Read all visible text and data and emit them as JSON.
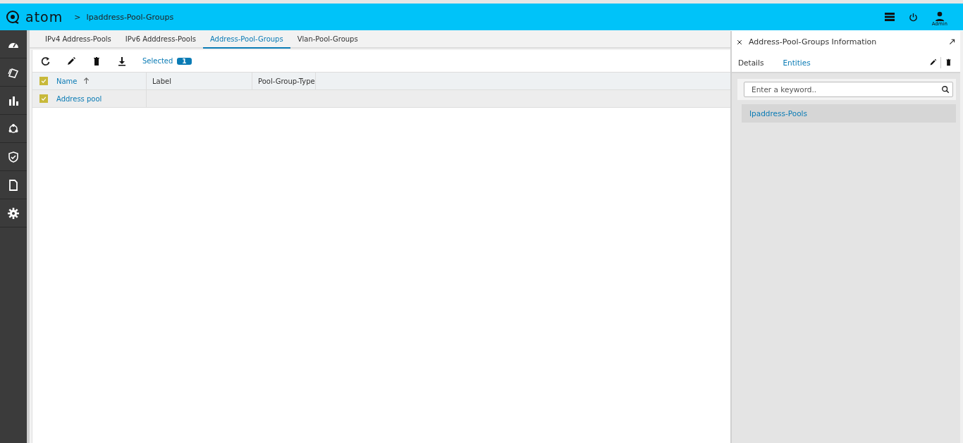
{
  "header": {
    "logo": "atom",
    "breadcrumb_separator": ">",
    "breadcrumb": "Ipaddress-Pool-Groups",
    "user": "Admin"
  },
  "tabs": [
    {
      "label": "IPv4 Address-Pools",
      "selected": false
    },
    {
      "label": "IPv6 Adddress-Pools",
      "selected": false
    },
    {
      "label": "Address-Pool-Groups",
      "selected": true
    },
    {
      "label": "Vlan-Pool-Groups",
      "selected": false
    }
  ],
  "toolbar": {
    "selected_label": "Selected",
    "selected_count": "1"
  },
  "table": {
    "all_checked": true,
    "columns": [
      {
        "label": "Name",
        "sorted": true
      },
      {
        "label": "Label",
        "sorted": false
      },
      {
        "label": "Pool-Group-Type",
        "sorted": false
      }
    ],
    "rows": [
      {
        "checked": true,
        "name": "Address pool"
      }
    ]
  },
  "panel": {
    "title": "Address-Pool-Groups Information",
    "tabs": [
      {
        "label": "Details",
        "selected": false
      },
      {
        "label": "Entities",
        "selected": true
      }
    ],
    "search": {
      "placeholder": "Enter a keyword.."
    },
    "items": [
      {
        "label": "Ipaddress-Pools"
      }
    ]
  }
}
